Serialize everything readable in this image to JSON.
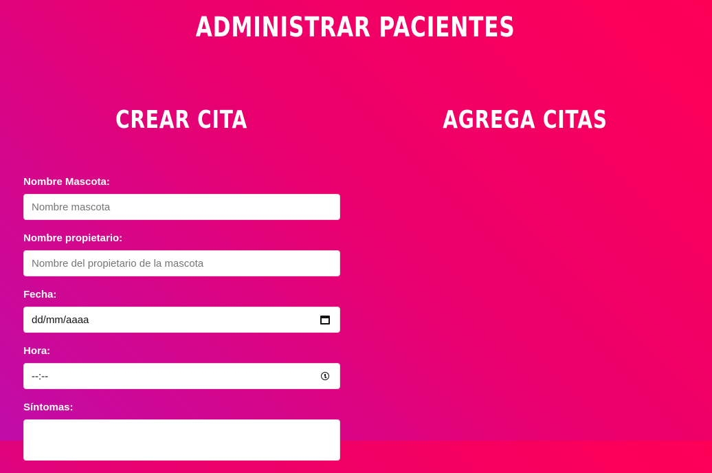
{
  "header": {
    "title": "ADMINISTRAR PACIENTES"
  },
  "columns": {
    "left_title": "CREAR CITA",
    "right_title": "AGREGA CITAS"
  },
  "form": {
    "pet_name": {
      "label": "Nombre Mascota:",
      "placeholder": "Nombre mascota"
    },
    "owner_name": {
      "label": "Nombre propietario:",
      "placeholder": "Nombre del propietario de la mascota"
    },
    "date": {
      "label": "Fecha:",
      "value": "dd/mm/aaaa",
      "icon": "calendar-icon"
    },
    "time": {
      "label": "Hora:",
      "value": "--:--",
      "icon": "clock-icon"
    },
    "symptoms": {
      "label": "Síntomas:",
      "value": ""
    }
  },
  "colors": {
    "gradient_start": "#c00ca9",
    "gradient_end": "#ff0056",
    "text": "#ffffff"
  }
}
